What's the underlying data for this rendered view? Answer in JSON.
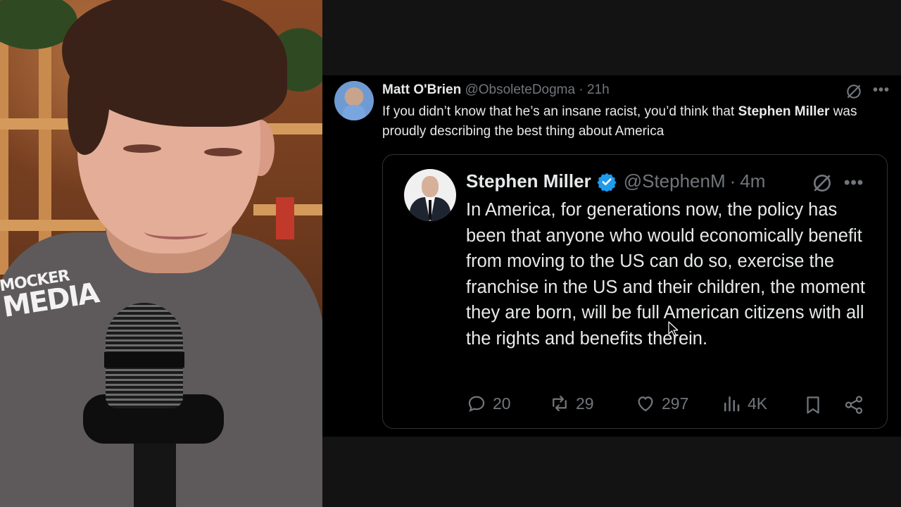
{
  "webcam": {
    "logo_line1": "MOCKER",
    "logo_line2": "MEDIA"
  },
  "tweet": {
    "author_name": "Matt O'Brien",
    "author_handle": "@ObsoleteDogma",
    "separator": "·",
    "time": "21h",
    "text_part1": "If you didn’t know that he’s an insane racist, you’d think that ",
    "text_bold": "Stephen Miller",
    "text_part2": " was proudly describing the best thing about America",
    "icons": [
      "grok-icon",
      "more-icon"
    ],
    "quoted": {
      "author_name": "Stephen Miller",
      "verified": true,
      "author_handle": "@StephenM",
      "separator": "·",
      "time": "4m",
      "text": "In America, for generations now, the policy has been that anyone who would economically benefit from moving to the US can do so, exercise the franchise in the US and their children, the moment they are born, will be full American citizens with all the rights and benefits therein.",
      "actions": {
        "replies": "20",
        "reposts": "29",
        "likes": "297",
        "views": "4K"
      },
      "icons": [
        "reply-icon",
        "repost-icon",
        "like-icon",
        "views-icon",
        "bookmark-icon",
        "share-icon",
        "grok-icon",
        "more-icon"
      ]
    }
  },
  "colors": {
    "background": "#000000",
    "text_primary": "#e7e9ea",
    "text_secondary": "#71767b",
    "verified": "#1d9bf0",
    "border": "#2f3336"
  }
}
